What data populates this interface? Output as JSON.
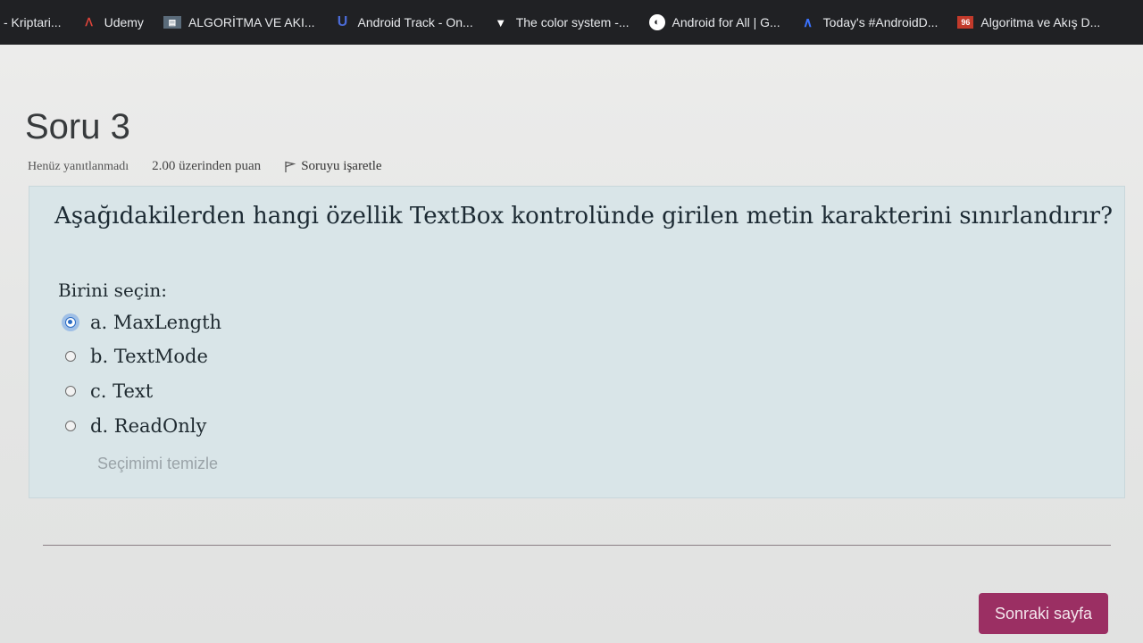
{
  "bookmarks": [
    {
      "label": "- Kriptari...",
      "icon": "none"
    },
    {
      "label": "Udemy",
      "icon": "udemy-icon",
      "glyph": "ᐱ"
    },
    {
      "label": "ALGORİTMA VE AKI...",
      "icon": "algoritma-icon",
      "glyph": "▤"
    },
    {
      "label": "Android Track - On...",
      "icon": "udacity-icon",
      "glyph": "U"
    },
    {
      "label": "The color system -...",
      "icon": "material-icon",
      "glyph": "▼"
    },
    {
      "label": "Android for All  |  G...",
      "icon": "android-for-all-icon",
      "glyph": "◐"
    },
    {
      "label": "Today's #AndroidD...",
      "icon": "today-icon",
      "glyph": "∧"
    },
    {
      "label": "Algoritma ve Akış D...",
      "icon": "algoritma-akis-icon",
      "glyph": "96"
    }
  ],
  "question": {
    "title": "Soru 3",
    "status": "Henüz yanıtlanmadı",
    "points": "2.00 üzerinden puan",
    "flag_label": "Soruyu işaretle",
    "text": "Aşağıdakilerden hangi özellik TextBox kontrolünde girilen metin karakterini sınırlandırır?",
    "prompt": "Birini seçin:",
    "options": [
      {
        "label": "a. MaxLength",
        "selected": true
      },
      {
        "label": "b. TextMode",
        "selected": false
      },
      {
        "label": "c. Text",
        "selected": false
      },
      {
        "label": "d. ReadOnly",
        "selected": false
      }
    ],
    "clear_label": "Seçimimi temizle"
  },
  "navigation": {
    "next_label": "Sonraki sayfa"
  },
  "colors": {
    "bookmarks_bar": "#202124",
    "question_box": "#d9e5e8",
    "next_button": "#9b2f63",
    "radio_selected": "#2b6cc4"
  }
}
